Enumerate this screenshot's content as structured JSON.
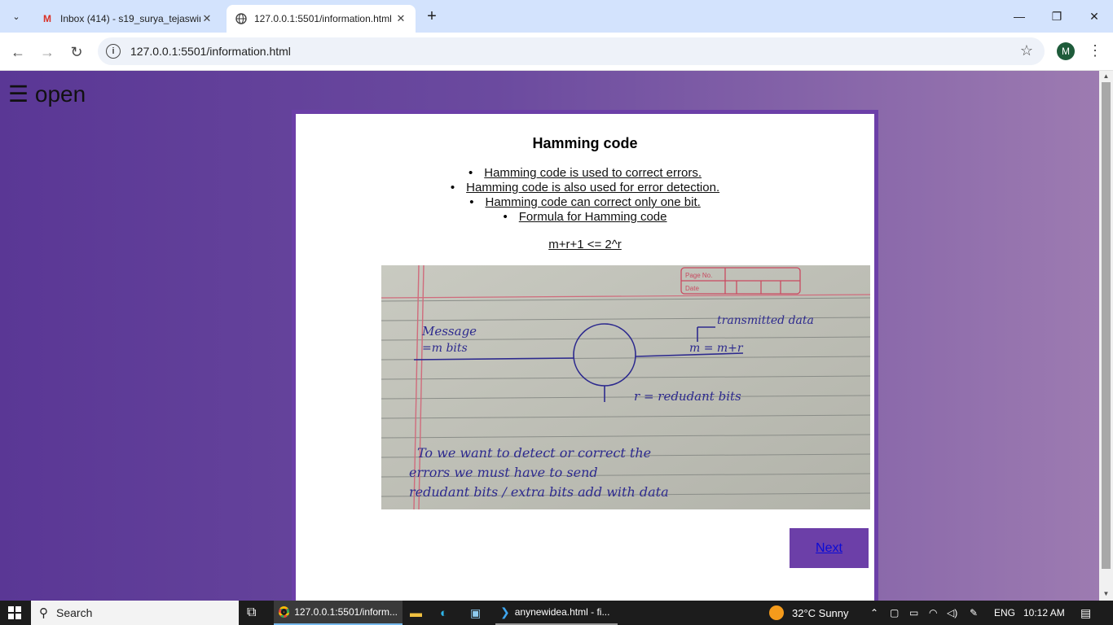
{
  "browser": {
    "tabs": [
      {
        "title": "Inbox (414) - s19_surya_tejaswini",
        "icon": "gmail-icon",
        "active": false
      },
      {
        "title": "127.0.0.1:5501/information.html",
        "icon": "globe-icon",
        "active": true
      }
    ],
    "url": "127.0.0.1:5501/information.html",
    "profile_initial": "M"
  },
  "page": {
    "open_label": "☰ open",
    "title": "Hamming code",
    "bullets": [
      "Hamming code is used to correct errors.",
      "Hamming code is also used for error detection.",
      "Hamming code can correct only one bit.",
      "Formula for Hamming code"
    ],
    "formula": "m+r+1 <= 2^r",
    "next_label": "Next",
    "notebook": {
      "header": [
        "Page No.",
        "Date"
      ],
      "lines": [
        "Message",
        "=m bits",
        "transmitted data",
        "m = m+r",
        "r = redudant bits",
        "To we want to detect or correct the",
        "errors we must have to send",
        "redudant bits / extra bits add with data"
      ]
    },
    "accent_color": "#6c3fa8"
  },
  "taskbar": {
    "search_label": "Search",
    "apps": [
      {
        "label": "127.0.0.1:5501/inform...",
        "icon": "chrome-icon"
      },
      {
        "label": "anynewidea.html - fi...",
        "icon": "vscode-icon"
      }
    ],
    "weather": "32°C  Sunny",
    "language": "ENG",
    "time": "10:12 AM"
  }
}
